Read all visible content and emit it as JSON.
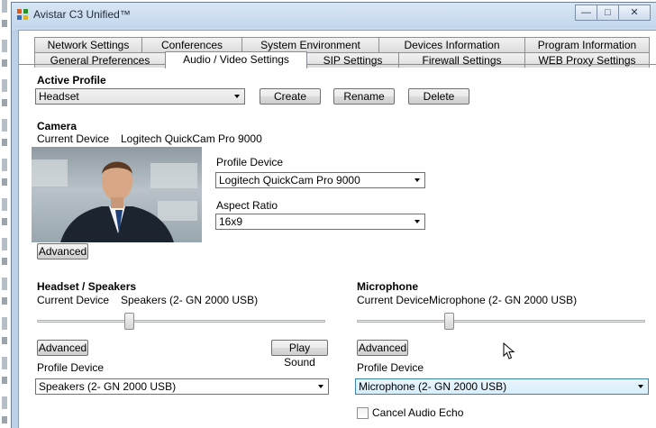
{
  "window": {
    "title": "Avistar C3 Unified™"
  },
  "tabs": {
    "top_row": [
      "Network Settings",
      "Conferences",
      "System Environment",
      "Devices Information",
      "Program Information"
    ],
    "bottom_row": [
      "General Preferences",
      "Audio / Video Settings",
      "SIP Settings",
      "Firewall Settings",
      "WEB Proxy Settings"
    ],
    "active": "Audio / Video Settings"
  },
  "active_profile": {
    "heading": "Active Profile",
    "value": "Headset",
    "create_label": "Create",
    "rename_label": "Rename",
    "delete_label": "Delete"
  },
  "camera": {
    "heading": "Camera",
    "current_device_label": "Current Device",
    "current_device_value": "Logitech QuickCam Pro 9000",
    "profile_device_label": "Profile Device",
    "profile_device_value": "Logitech QuickCam Pro 9000",
    "aspect_ratio_label": "Aspect Ratio",
    "aspect_ratio_value": "16x9",
    "advanced_label": "Advanced"
  },
  "headset": {
    "heading": "Headset / Speakers",
    "current_device_label": "Current Device",
    "current_device_value": "Speakers (2- GN 2000 USB)",
    "volume_level": 0.32,
    "advanced_label": "Advanced",
    "play_sound_label": "Play Sound",
    "profile_device_label": "Profile Device",
    "profile_device_value": "Speakers (2- GN 2000 USB)"
  },
  "microphone": {
    "heading": "Microphone",
    "current_device_label": "Current Device",
    "current_device_value": "Microphone (2- GN 2000 USB)",
    "volume_level": 0.32,
    "advanced_label": "Advanced",
    "profile_device_label": "Profile Device",
    "profile_device_value": "Microphone (2- GN 2000 USB)",
    "cancel_echo_label": "Cancel Audio Echo",
    "cancel_echo_checked": false
  },
  "colors": {
    "titlebar": "#c9dbee",
    "selected_combo_border": "#3c7fb1"
  }
}
